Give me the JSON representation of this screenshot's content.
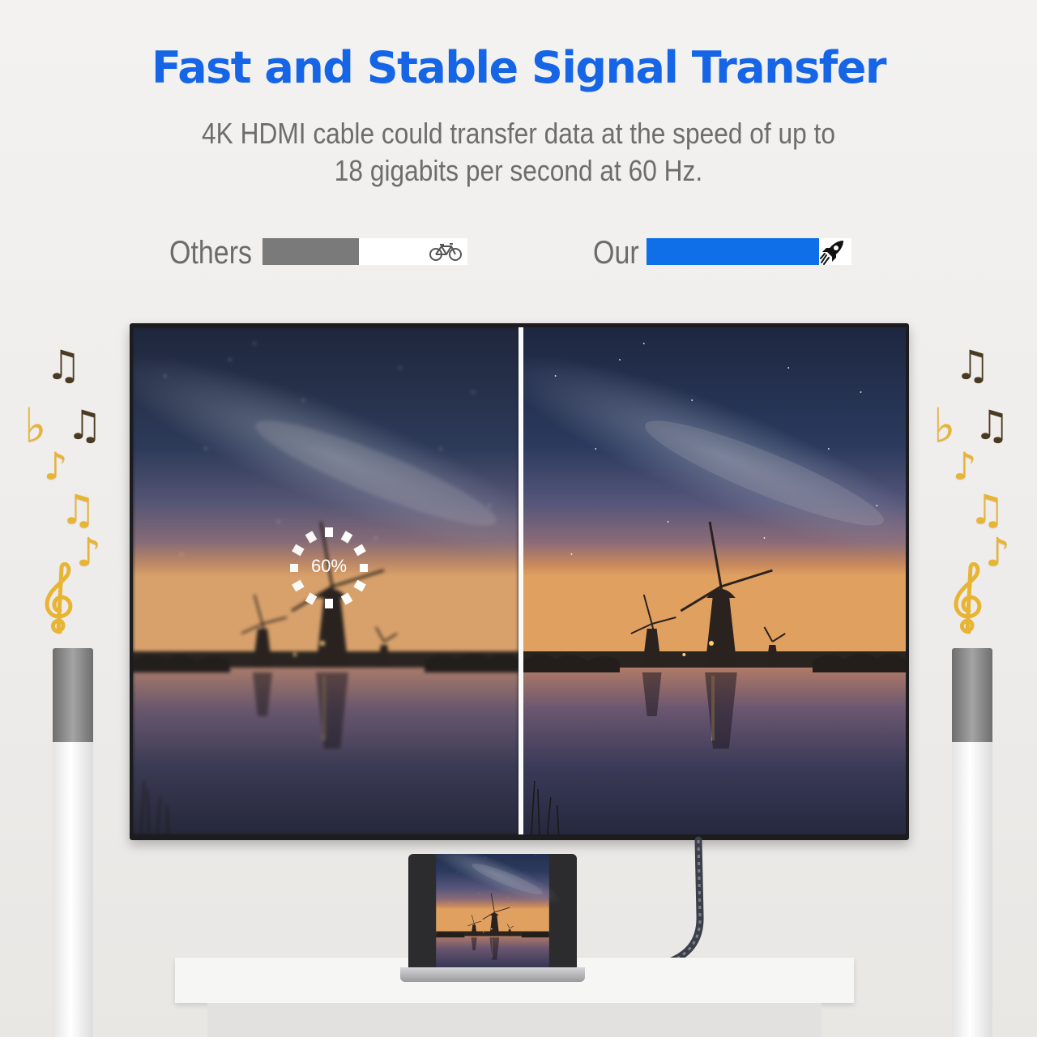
{
  "headline": "Fast and Stable Signal Transfer",
  "subtitle": {
    "line1": "4K HDMI cable could transfer data at the speed of up to",
    "line2": "18 gigabits per second at 60 Hz."
  },
  "comparison": {
    "others": {
      "label": "Others",
      "fill_fraction": 0.47,
      "fill_color": "#7a7a7a",
      "icon": "bicycle-icon"
    },
    "ours": {
      "label": "Our",
      "fill_fraction": 0.84,
      "fill_color": "#0f6fe8",
      "icon": "rocket-icon"
    }
  },
  "loading": {
    "percent_label": "60%",
    "progress_fraction": 0.6
  },
  "colors": {
    "accent": "#1565e6",
    "note_gold": "#e7b434"
  }
}
